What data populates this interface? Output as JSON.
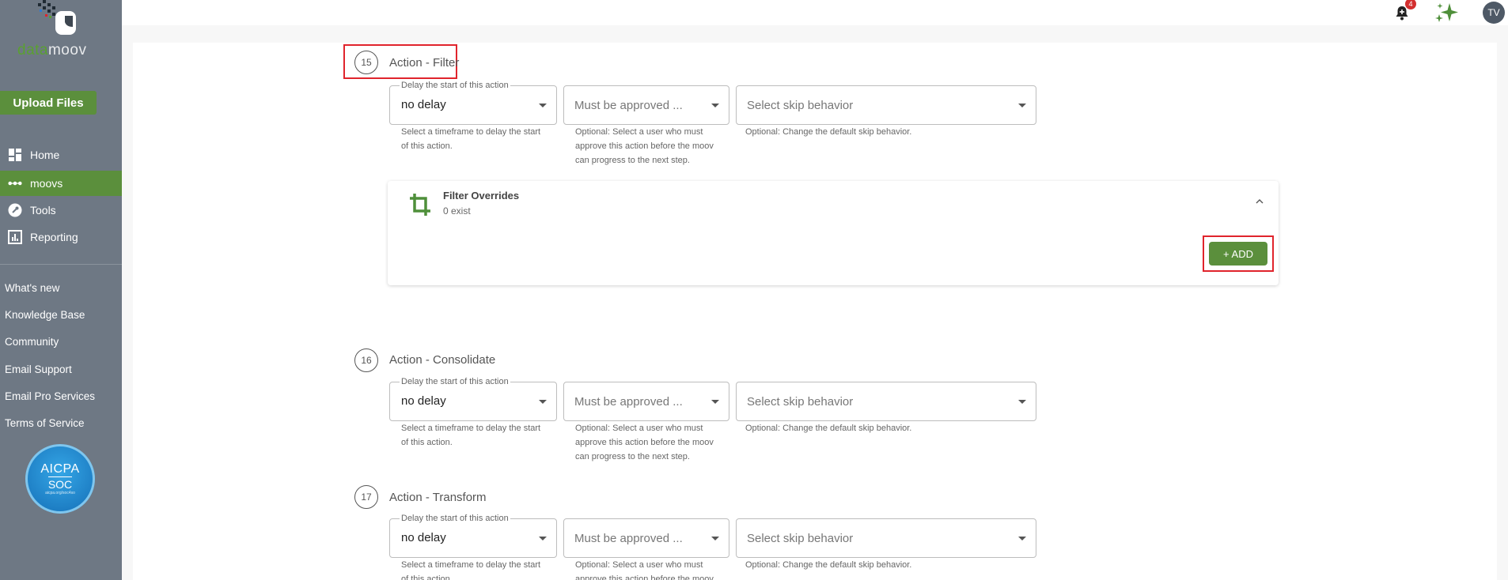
{
  "sidebar": {
    "logo": {
      "part1": "data",
      "part2": "moov"
    },
    "upload_label": "Upload Files",
    "nav": [
      {
        "label": "Home",
        "icon": "dashboard-icon"
      },
      {
        "label": "moovs",
        "icon": "dots-icon"
      },
      {
        "label": "Tools",
        "icon": "wrench-icon"
      },
      {
        "label": "Reporting",
        "icon": "chart-icon"
      }
    ],
    "links": [
      "What's new",
      "Knowledge Base",
      "Community",
      "Email Support",
      "Email Pro Services",
      "Terms of Service"
    ],
    "badge": {
      "t1": "AICPA",
      "t2": "SOC",
      "t3": "aicpa.org/soc4so"
    }
  },
  "topbar": {
    "notification_count": "4",
    "avatar_initials": "TV"
  },
  "steps": [
    {
      "number": "15",
      "title": "Action - Filter",
      "delay_legend": "Delay the start of this action",
      "delay_value": "no delay",
      "delay_helper": "Select a timeframe to delay the start of this action.",
      "approve_placeholder": "Must be approved ...",
      "approve_helper": "Optional: Select a user who must approve this action before the moov can progress to the next step.",
      "skip_placeholder": "Select skip behavior",
      "skip_helper": "Optional: Change the default skip behavior."
    },
    {
      "number": "16",
      "title": "Action - Consolidate",
      "delay_legend": "Delay the start of this action",
      "delay_value": "no delay",
      "delay_helper": "Select a timeframe to delay the start of this action.",
      "approve_placeholder": "Must be approved ...",
      "approve_helper": "Optional: Select a user who must approve this action before the moov can progress to the next step.",
      "skip_placeholder": "Select skip behavior",
      "skip_helper": "Optional: Change the default skip behavior."
    },
    {
      "number": "17",
      "title": "Action - Transform",
      "delay_legend": "Delay the start of this action",
      "delay_value": "no delay",
      "delay_helper": "Select a timeframe to delay the start of this action.",
      "approve_placeholder": "Must be approved ...",
      "approve_helper": "Optional: Select a user who must approve this action before the moov can progress to the next step.",
      "skip_placeholder": "Select skip behavior",
      "skip_helper": "Optional: Change the default skip behavior."
    }
  ],
  "filter_overrides": {
    "title": "Filter Overrides",
    "subtitle": "0 exist",
    "add_label": "+ ADD"
  },
  "colors": {
    "brand_green": "#5b8f3c",
    "sidebar_bg": "#6e7884",
    "highlight_red": "#e0242c",
    "notification_red": "#d32f2f"
  }
}
